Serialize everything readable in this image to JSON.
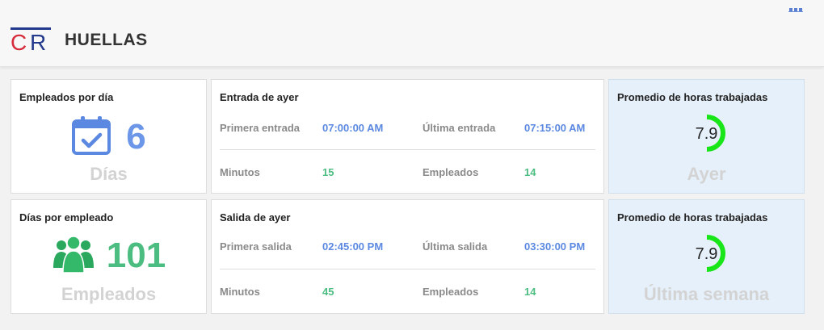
{
  "header": {
    "logo_text": "CR",
    "title": "HUELLAS",
    "menu_icon": "dots-icon"
  },
  "colors": {
    "blue": "#5b88e0",
    "green": "#4cbd81",
    "gauge_green": "#19e619",
    "muted": "#d3d3d3",
    "logo_red": "#d72a3a",
    "logo_blue": "#233a8c"
  },
  "cards": {
    "employees_per_day": {
      "title": "Empleados por día",
      "icon": "calendar-check-icon",
      "value": "6",
      "caption": "Días"
    },
    "days_per_employee": {
      "title": "Días por empleado",
      "icon": "users-group-icon",
      "value": "101",
      "caption": "Empleados"
    },
    "entry_yesterday": {
      "title": "Entrada de ayer",
      "first_label": "Primera entrada",
      "first_value": "07:00:00 AM",
      "last_label": "Última entrada",
      "last_value": "07:15:00 AM",
      "minutes_label": "Minutos",
      "minutes_value": "15",
      "employees_label": "Empleados",
      "employees_value": "14"
    },
    "exit_yesterday": {
      "title": "Salida de ayer",
      "first_label": "Primera salida",
      "first_value": "02:45:00 PM",
      "last_label": "Última salida",
      "last_value": "03:30:00 PM",
      "minutes_label": "Minutos",
      "minutes_value": "45",
      "employees_label": "Empleados",
      "employees_value": "14"
    },
    "avg_hours_yesterday": {
      "title": "Promedio de horas trabajadas",
      "value": "7.9",
      "fill": 0.5,
      "caption": "Ayer"
    },
    "avg_hours_last_week": {
      "title": "Promedio de horas trabajadas",
      "value": "7.9",
      "fill": 0.5,
      "caption": "Última semana"
    }
  }
}
